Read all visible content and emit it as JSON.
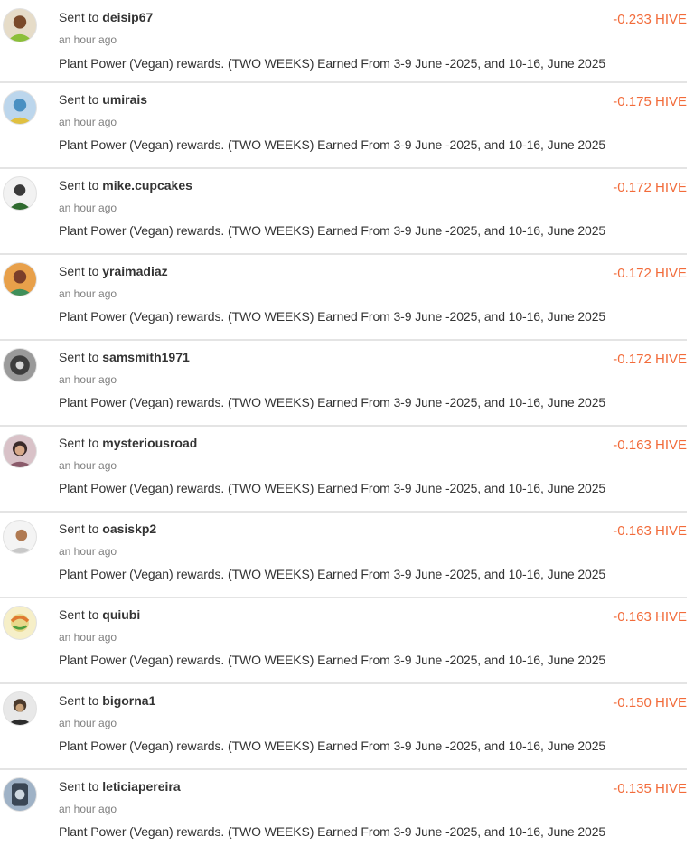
{
  "transactions": [
    {
      "prefix": "Sent to",
      "user": "deisip67",
      "time": "an hour ago",
      "memo": "Plant Power (Vegan) rewards. (TWO WEEKS) Earned From 3-9 June -2025, and 10-16, June 2025",
      "amount": "-0.233 HIVE",
      "avatar_icon": "user-avatar-icon",
      "avatar_color": "#6b8e23"
    },
    {
      "prefix": "Sent to",
      "user": "umirais",
      "time": "an hour ago",
      "memo": "Plant Power (Vegan) rewards. (TWO WEEKS) Earned From 3-9 June -2025, and 10-16, June 2025",
      "amount": "-0.175 HIVE",
      "avatar_icon": "user-avatar-icon",
      "avatar_color": "#4a90c2"
    },
    {
      "prefix": "Sent to",
      "user": "mike.cupcakes",
      "time": "an hour ago",
      "memo": "Plant Power (Vegan) rewards. (TWO WEEKS) Earned From 3-9 June -2025, and 10-16, June 2025",
      "amount": "-0.172 HIVE",
      "avatar_icon": "user-avatar-icon",
      "avatar_color": "#5a5a5a"
    },
    {
      "prefix": "Sent to",
      "user": "yraimadiaz",
      "time": "an hour ago",
      "memo": "Plant Power (Vegan) rewards. (TWO WEEKS) Earned From 3-9 June -2025, and 10-16, June 2025",
      "amount": "-0.172 HIVE",
      "avatar_icon": "user-avatar-icon",
      "avatar_color": "#c9893f"
    },
    {
      "prefix": "Sent to",
      "user": "samsmith1971",
      "time": "an hour ago",
      "memo": "Plant Power (Vegan) rewards. (TWO WEEKS) Earned From 3-9 June -2025, and 10-16, June 2025",
      "amount": "-0.172 HIVE",
      "avatar_icon": "user-avatar-icon",
      "avatar_color": "#3d3d3d"
    },
    {
      "prefix": "Sent to",
      "user": "mysteriousroad",
      "time": "an hour ago",
      "memo": "Plant Power (Vegan) rewards. (TWO WEEKS) Earned From 3-9 June -2025, and 10-16, June 2025",
      "amount": "-0.163 HIVE",
      "avatar_icon": "user-avatar-icon",
      "avatar_color": "#8a5a6a"
    },
    {
      "prefix": "Sent to",
      "user": "oasiskp2",
      "time": "an hour ago",
      "memo": "Plant Power (Vegan) rewards. (TWO WEEKS) Earned From 3-9 June -2025, and 10-16, June 2025",
      "amount": "-0.163 HIVE",
      "avatar_icon": "user-avatar-icon",
      "avatar_color": "#b07a52"
    },
    {
      "prefix": "Sent to",
      "user": "quiubi",
      "time": "an hour ago",
      "memo": "Plant Power (Vegan) rewards. (TWO WEEKS) Earned From 3-9 June -2025, and 10-16, June 2025",
      "amount": "-0.163 HIVE",
      "avatar_icon": "user-avatar-icon",
      "avatar_color": "#e8d88a"
    },
    {
      "prefix": "Sent to",
      "user": "bigorna1",
      "time": "an hour ago",
      "memo": "Plant Power (Vegan) rewards. (TWO WEEKS) Earned From 3-9 June -2025, and 10-16, June 2025",
      "amount": "-0.150 HIVE",
      "avatar_icon": "user-avatar-icon",
      "avatar_color": "#4b3a2c"
    },
    {
      "prefix": "Sent to",
      "user": "leticiapereira",
      "time": "an hour ago",
      "memo": "Plant Power (Vegan) rewards. (TWO WEEKS) Earned From 3-9 June -2025, and 10-16, June 2025",
      "amount": "-0.135 HIVE",
      "avatar_icon": "user-avatar-icon",
      "avatar_color": "#5b6f86"
    }
  ],
  "colors": {
    "amount_negative": "#f26b3a",
    "divider": "#e4e4e4",
    "muted_text": "#808080"
  }
}
